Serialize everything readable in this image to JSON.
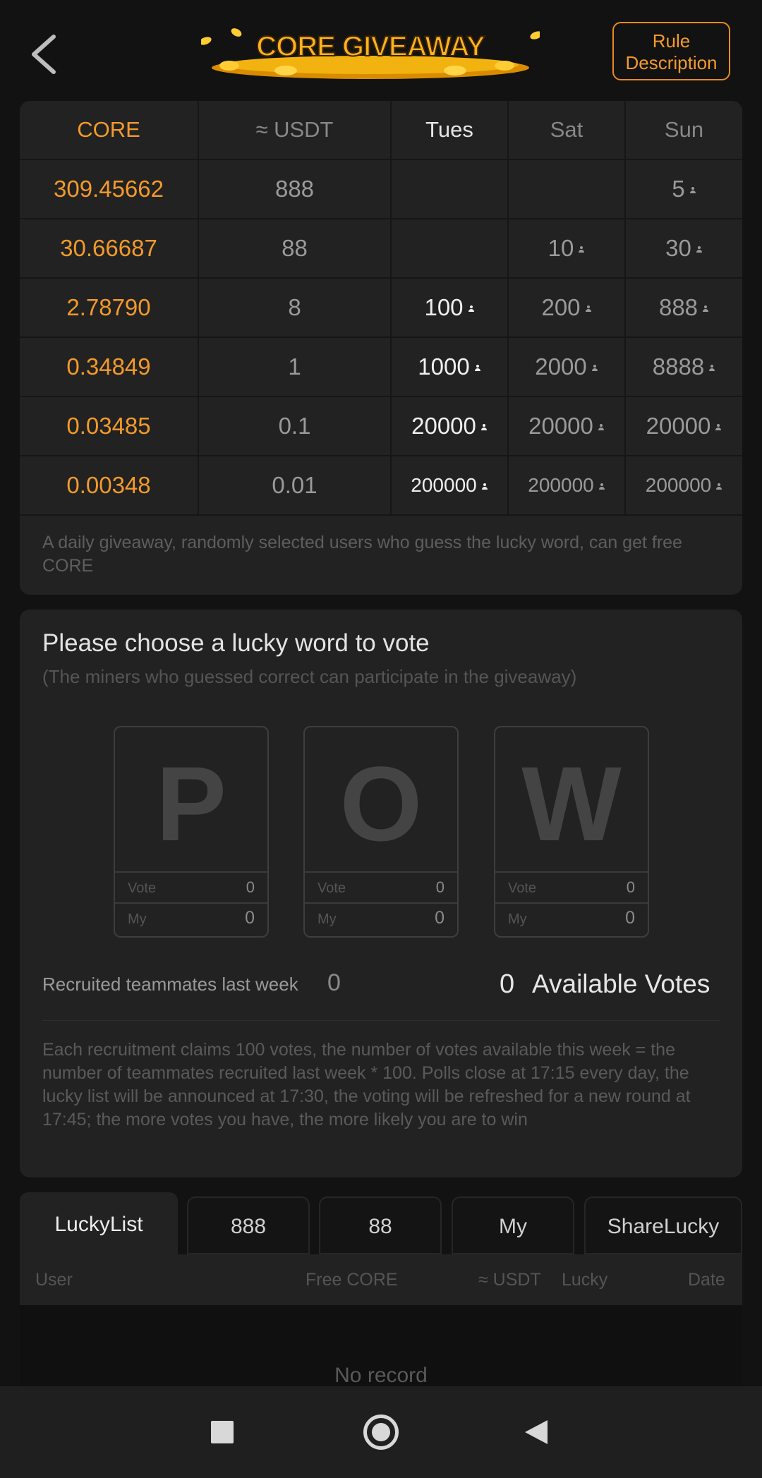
{
  "header": {
    "back_icon": "chevron-left-icon",
    "title": "CORE GIVEAWAY",
    "rule_button": "Rule\nDescription"
  },
  "prize_table": {
    "columns": [
      "CORE",
      "≈ USDT",
      "Tues",
      "Sat",
      "Sun"
    ],
    "rows": [
      {
        "core": "309.45662",
        "usdt": "888",
        "tues": "",
        "sat": "",
        "sun": "5"
      },
      {
        "core": "30.66687",
        "usdt": "88",
        "tues": "",
        "sat": "10",
        "sun": "30"
      },
      {
        "core": "2.78790",
        "usdt": "8",
        "tues": "100",
        "sat": "200",
        "sun": "888"
      },
      {
        "core": "0.34849",
        "usdt": "1",
        "tues": "1000",
        "sat": "2000",
        "sun": "8888"
      },
      {
        "core": "0.03485",
        "usdt": "0.1",
        "tues": "20000",
        "sat": "20000",
        "sun": "20000"
      },
      {
        "core": "0.00348",
        "usdt": "0.01",
        "tues": "200000",
        "sat": "200000",
        "sun": "200000"
      }
    ],
    "description": "A daily giveaway, randomly selected users who guess the lucky word, can get free CORE",
    "accent_color": "#f39a2b"
  },
  "vote": {
    "title": "Please choose a lucky word to vote",
    "subtitle": "(The miners who guessed correct can participate in the giveaway)",
    "letters": [
      {
        "letter": "P",
        "vote_label": "Vote",
        "vote_value": "0",
        "my_label": "My",
        "my_value": "0"
      },
      {
        "letter": "O",
        "vote_label": "Vote",
        "vote_value": "0",
        "my_label": "My",
        "my_value": "0"
      },
      {
        "letter": "W",
        "vote_label": "Vote",
        "vote_value": "0",
        "my_label": "My",
        "my_value": "0"
      }
    ],
    "recruited_label": "Recruited teammates last week",
    "recruited_value": "0",
    "available_votes_value": "0",
    "available_votes_label": "Available Votes",
    "description": "Each recruitment claims 100 votes, the number of votes available this week = the number of teammates recruited last week * 100. Polls close at 17:15 every day, the lucky list will be announced at 17:30, the voting will be refreshed for a new round at 17:45; the more votes you have, the more likely you are to win"
  },
  "tabs": [
    "LuckyList",
    "888",
    "88",
    "My",
    "ShareLucky"
  ],
  "list": {
    "columns": [
      "User",
      "Free CORE",
      "≈ USDT",
      "Lucky",
      "Date"
    ],
    "empty_text": "No record"
  },
  "navbar": {
    "icons": [
      "recent-apps-icon",
      "home-icon",
      "back-triangle-icon"
    ]
  }
}
